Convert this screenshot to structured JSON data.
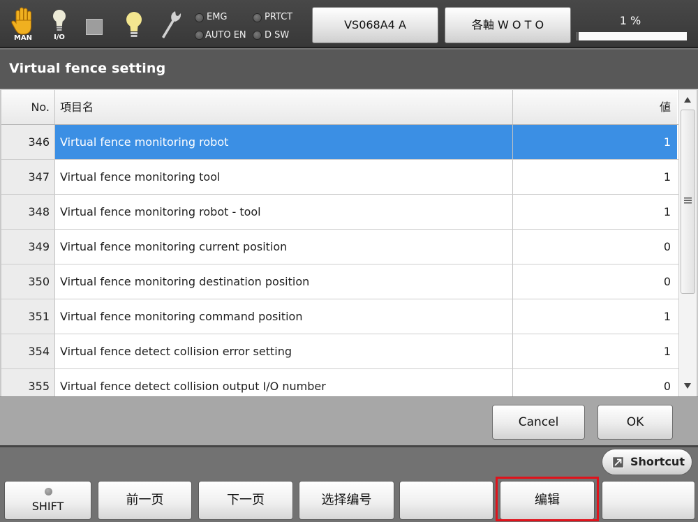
{
  "status_bar": {
    "mode_label": "MAN",
    "io_label": "I/O",
    "indicators": {
      "emg": "EMG",
      "prtct": "PRTCT",
      "auto_en": "AUTO EN",
      "dsw": "D SW"
    },
    "robot_button": "VS068A4 A",
    "axis_button": "各軸 W O T O",
    "speed_label": "1 %",
    "speed_percent": 1
  },
  "page_title": "Virtual fence setting",
  "table": {
    "headers": {
      "no": "No.",
      "name": "項目名",
      "value": "値"
    },
    "selected_index": 0,
    "rows": [
      {
        "no": "346",
        "name": "Virtual fence monitoring robot",
        "value": "1"
      },
      {
        "no": "347",
        "name": "Virtual fence monitoring tool",
        "value": "1"
      },
      {
        "no": "348",
        "name": "Virtual fence monitoring robot - tool",
        "value": "1"
      },
      {
        "no": "349",
        "name": "Virtual fence monitoring current position",
        "value": "0"
      },
      {
        "no": "350",
        "name": "Virtual fence monitoring destination position",
        "value": "0"
      },
      {
        "no": "351",
        "name": "Virtual fence monitoring command position",
        "value": "1"
      },
      {
        "no": "354",
        "name": "Virtual fence detect collision error setting",
        "value": "1"
      },
      {
        "no": "355",
        "name": "Virtual fence detect collision output I/O number",
        "value": "0"
      }
    ]
  },
  "dialog": {
    "cancel_label": "Cancel",
    "ok_label": "OK"
  },
  "shortcut_label": "Shortcut",
  "function_keys": {
    "shift": "SHIFT",
    "prev_page": "前一页",
    "next_page": "下一页",
    "select_number": "选择编号",
    "edit": "编辑"
  },
  "icons": {
    "mode": "hand-icon",
    "io": "lightbulb-icon",
    "stop": "square-icon",
    "lamp": "lightbulb-icon",
    "tool": "wrench-icon",
    "shortcut": "external-link-icon"
  },
  "colors": {
    "selection": "#3b8fe4",
    "highlight_outline": "#e0121b",
    "mode_icon": "#f0b020"
  }
}
